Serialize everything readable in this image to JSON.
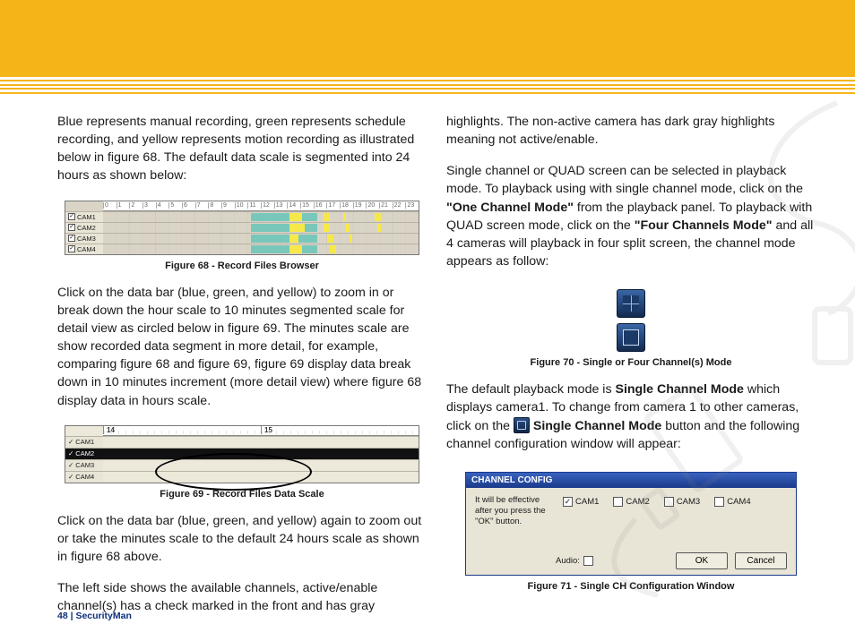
{
  "header": {},
  "left": {
    "p1": "Blue represents manual recording, green represents schedule recording, and yellow represents motion recording as illustrated below in figure 68.  The default data scale is segmented into 24 hours as shown below:",
    "caption68": "Figure 68 - Record Files Browser",
    "p2": "Click on the data bar (blue, green, and yellow) to zoom in or break down the hour scale to 10 minutes segmented scale for detail view as circled below in figure 69.  The minutes scale are show recorded data segment in more detail, for example, comparing figure 68 and figure 69, figure 69 display data break down in 10 minutes increment (more detail view) where figure 68 display data in hours scale.",
    "caption69": "Figure 69 - Record Files Data Scale",
    "p3": "Click on the data bar (blue, green, and yellow) again to zoom out or take the minutes scale to the default 24 hours scale as shown in figure 68 above.",
    "p4": "The left side shows the available channels, active/enable channel(s) has a check marked in the front and has gray"
  },
  "right": {
    "p1": "highlights.  The non-active camera has dark gray highlights meaning not active/enable.",
    "p2a": "Single channel or QUAD screen can be selected in playback mode.  To playback using with single channel mode, click on the ",
    "p2b": "\"One Channel Mode\"",
    "p2c": " from the playback panel.  To playback with QUAD screen mode, click on the ",
    "p2d": "\"Four Channels Mode\"",
    "p2e": " and all 4 cameras will playback in four split screen, the channel mode appears as follow:",
    "caption70": "Figure 70 - Single or Four Channel(s) Mode",
    "p3a": "The default playback mode is ",
    "p3b": "Single Channel Mode",
    "p3c": " which displays camera1. To change from camera 1 to other cameras, click on the ",
    "p3d": " Single Channel Mode",
    "p3e": " button and the following channel configuration window will appear:",
    "caption71": "Figure 71 - Single CH Configuration Window"
  },
  "fig68": {
    "ticks": [
      "0",
      "1",
      "2",
      "3",
      "4",
      "5",
      "6",
      "7",
      "8",
      "9",
      "10",
      "11",
      "12",
      "13",
      "14",
      "15",
      "16",
      "17",
      "18",
      "19",
      "20",
      "21",
      "22",
      "23"
    ],
    "rows": [
      "CAM1",
      "CAM2",
      "CAM3",
      "CAM4"
    ]
  },
  "fig69": {
    "hours": [
      "14",
      "15"
    ],
    "rows": [
      "CAM1",
      "CAM2",
      "CAM3",
      "CAM4"
    ]
  },
  "fig71": {
    "title": "CHANNEL CONFIG",
    "note": "It will be effective after you press the \"OK\" button.",
    "cams": [
      "CAM1",
      "CAM2",
      "CAM3",
      "CAM4"
    ],
    "audio": "Audio:",
    "ok": "OK",
    "cancel": "Cancel"
  },
  "footer": "48  |  SecurityMan"
}
